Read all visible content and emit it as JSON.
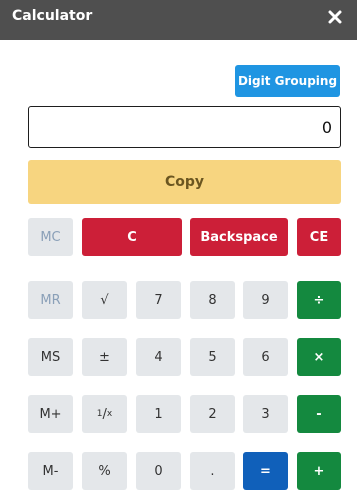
{
  "window": {
    "title": "Calculator",
    "close_icon": "close-icon"
  },
  "toolbar": {
    "digit_grouping_label": "Digit Grouping"
  },
  "display": {
    "value": "0"
  },
  "copy_label": "Copy",
  "keys": {
    "mc": "MC",
    "clear": "C",
    "backspace": "Backspace",
    "ce": "CE",
    "mr": "MR",
    "sqrt": "√",
    "seven": "7",
    "eight": "8",
    "nine": "9",
    "divide": "÷",
    "ms": "MS",
    "plusminus": "±",
    "four": "4",
    "five": "5",
    "six": "6",
    "multiply": "×",
    "mplus": "M+",
    "reciprocal_num": "1",
    "reciprocal_den": "x",
    "one": "1",
    "two": "2",
    "three": "3",
    "minus": "-",
    "mminus": "M-",
    "percent": "%",
    "zero": "0",
    "decimal": ".",
    "equals": "=",
    "plus": "+"
  },
  "colors": {
    "titlebar": "#4f4f4f",
    "digit_grouping": "#1f95e2",
    "copy": "#f7d580",
    "red": "#cc1f38",
    "green": "#14893f",
    "blue": "#1060ba",
    "gray": "#e4e7ea"
  }
}
